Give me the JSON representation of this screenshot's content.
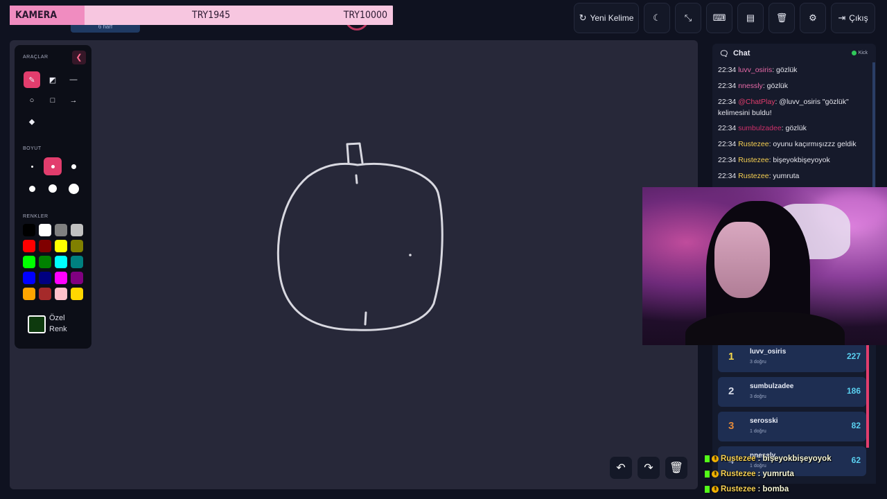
{
  "goal": {
    "label": "KAMERA",
    "current": "TRY1945",
    "target": "TRY10000",
    "progress": 0.1945,
    "under_text": "6 harf"
  },
  "toolbar": {
    "new_word": "Yeni Kelime",
    "logout": "Çıkış",
    "icons": [
      "refresh-icon",
      "moon-icon",
      "compress-icon",
      "keyboard-icon",
      "archive-icon",
      "trash-icon",
      "gear-icon",
      "logout-icon"
    ]
  },
  "tools": {
    "section_tools": "ARAÇLAR",
    "section_size": "BOYUT",
    "section_colors": "RENKLER",
    "custom_color_line1": "Özel",
    "custom_color_line2": "Renk",
    "colors": [
      [
        "#000000",
        "#ffffff",
        "#808080",
        "#c0c0c0"
      ],
      [
        "#ff0000",
        "#800000",
        "#ffff00",
        "#808000"
      ],
      [
        "#00ff00",
        "#008000",
        "#00ffff",
        "#008080"
      ],
      [
        "#0000ff",
        "#000080",
        "#ff00ff",
        "#800080"
      ],
      [
        "#ffa500",
        "#a52a2a",
        "#ffc0cb",
        "#ffd700"
      ]
    ],
    "custom_color": "#0e3a0e",
    "accent": "#e23d6d"
  },
  "chat": {
    "title": "Chat",
    "platform": "Kick",
    "messages": [
      {
        "time": "22:34",
        "user": "luvv_osiris",
        "color": "#e86aa8",
        "text": ": gözlük"
      },
      {
        "time": "22:34",
        "user": "nnessly",
        "color": "#e86aa8",
        "text": ": gözlük"
      },
      {
        "time": "22:34",
        "user": "@ChatPlay",
        "color": "#e23d6d",
        "text": ": @luvv_osiris \"gözlük\" kelimesini buldu!"
      },
      {
        "time": "22:34",
        "user": "sumbulzadee",
        "color": "#d0306a",
        "text": ": gözlük"
      },
      {
        "time": "22:34",
        "user": "Rustezee",
        "color": "#f5cf52",
        "text": ": oyunu kaçırmışızzz geldik"
      },
      {
        "time": "22:34",
        "user": "Rustezee",
        "color": "#f5cf52",
        "text": ": bişeyokbişeyoyok"
      },
      {
        "time": "22:34",
        "user": "Rustezee",
        "color": "#f5cf52",
        "text": ": yumruta"
      }
    ]
  },
  "leaderboard": [
    {
      "rank": "1",
      "name": "luvv_osiris",
      "sub": "3 doğru",
      "points": "227",
      "rank_color": "#f5d84a"
    },
    {
      "rank": "2",
      "name": "sumbulzadee",
      "sub": "3 doğru",
      "points": "186",
      "rank_color": "#d8dce8"
    },
    {
      "rank": "3",
      "name": "serosski",
      "sub": "1 doğru",
      "points": "82",
      "rank_color": "#e0883a"
    },
    {
      "rank": "4",
      "name": "nnessly",
      "sub": "1 doğru",
      "points": "62",
      "rank_color": "#9eabc8"
    }
  ],
  "overlay_chat": [
    {
      "user": "Rustezee",
      "text": " : bişeyokbişeyoyok"
    },
    {
      "user": "Rustezee",
      "text": " : yumruta"
    },
    {
      "user": "Rustezee",
      "text": " : bomba"
    }
  ]
}
